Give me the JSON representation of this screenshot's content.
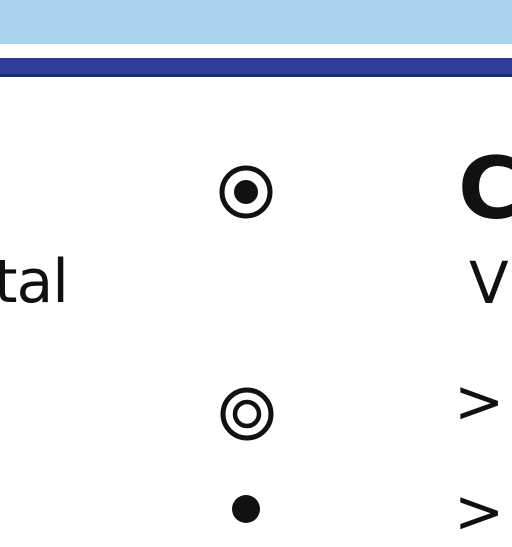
{
  "header": {
    "column_letter": "C"
  },
  "rows": [
    {
      "label": "tal"
    }
  ],
  "cells": {
    "row1_right": "V",
    "row2_right": ">",
    "row3_right": ">"
  },
  "symbols": [
    {
      "name": "filled-circle-in-ring"
    },
    {
      "name": "double-ring"
    },
    {
      "name": "solid-dot"
    }
  ],
  "colors": {
    "top_band": "#a7d3f0",
    "navy_rule": "#2f3f97",
    "ink": "#111111"
  }
}
